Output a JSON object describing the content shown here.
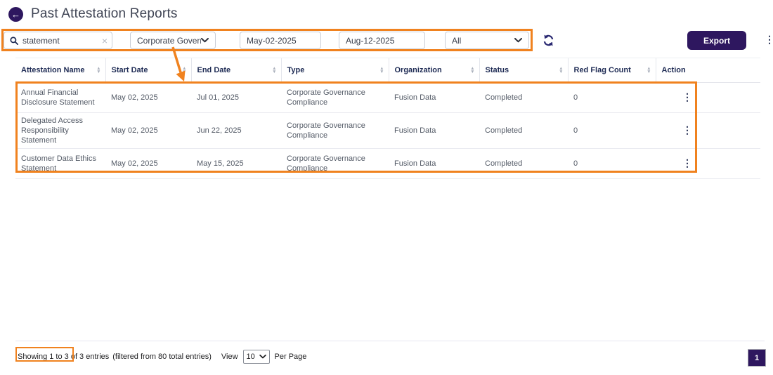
{
  "colors": {
    "brand_purple": "#2E175F",
    "annotation_orange": "#F0821F",
    "header_text": "#1E2B54",
    "cell_text": "#535A66",
    "refresh_icon": "#2B2A72"
  },
  "page": {
    "title": "Past Attestation Reports"
  },
  "filters": {
    "search": {
      "value": "statement"
    },
    "type_select": {
      "value": "Corporate Goverr"
    },
    "start_date": {
      "value": "May-02-2025"
    },
    "end_date": {
      "value": "Aug-12-2025"
    },
    "status_select": {
      "value": "All"
    },
    "export_label": "Export"
  },
  "icons": {
    "back": "arrow-left",
    "search": "magnifier",
    "clear": "×",
    "select_chevron": "chevron-down",
    "refresh": "sync-arrows",
    "kebab": "⋮",
    "sort_up": "▲",
    "sort_down": "▼"
  },
  "table": {
    "columns": [
      {
        "label": "Attestation Name",
        "sortable": true
      },
      {
        "label": "Start Date",
        "sortable": true
      },
      {
        "label": "End Date",
        "sortable": true
      },
      {
        "label": "Type",
        "sortable": true
      },
      {
        "label": "Organization",
        "sortable": true
      },
      {
        "label": "Status",
        "sortable": true
      },
      {
        "label": "Red Flag Count",
        "sortable": true
      },
      {
        "label": "Action",
        "sortable": false
      }
    ],
    "rows": [
      {
        "name": "Annual Financial Disclosure Statement",
        "start_date": "May 02, 2025",
        "end_date": "Jul 01, 2025",
        "type": "Corporate Governance Compliance",
        "organization": "Fusion Data",
        "status": "Completed",
        "red_flag_count": "0"
      },
      {
        "name": "Delegated Access Responsibility Statement",
        "start_date": "May 02, 2025",
        "end_date": "Jun 22, 2025",
        "type": "Corporate Governance Compliance",
        "organization": "Fusion Data",
        "status": "Completed",
        "red_flag_count": "0"
      },
      {
        "name": "Customer Data Ethics Statement",
        "start_date": "May 02, 2025",
        "end_date": "May 15, 2025",
        "type": "Corporate Governance Compliance",
        "organization": "Fusion Data",
        "status": "Completed",
        "red_flag_count": "0"
      }
    ]
  },
  "footer": {
    "showing": "Showing 1 to 3 of 3 entries",
    "filtered": "(filtered from 80 total entries)",
    "view_label": "View",
    "page_size": "10",
    "per_page_label": "Per Page",
    "current_page": "1"
  }
}
